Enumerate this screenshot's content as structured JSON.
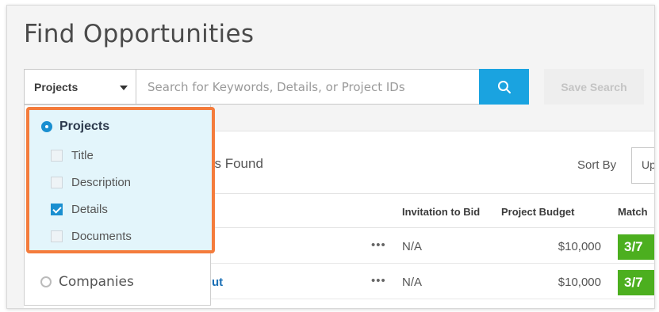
{
  "page": {
    "title": "Find Opportunities"
  },
  "search": {
    "type_selected": "Projects",
    "placeholder": "Search for Keywords, Details, or Project IDs",
    "search_icon": "search-icon",
    "save_label": "Save Search"
  },
  "dropdown": {
    "projects_label": "Projects",
    "projects_checked": true,
    "checkboxes": [
      {
        "label": "Title",
        "checked": false
      },
      {
        "label": "Description",
        "checked": false
      },
      {
        "label": "Details",
        "checked": true
      },
      {
        "label": "Documents",
        "checked": false
      }
    ],
    "companies_label": "Companies",
    "companies_checked": false
  },
  "results": {
    "count_text": "lts Found",
    "sort_label": "Sort By",
    "sort_value": "Up",
    "columns": {
      "invitation": "Invitation to Bid",
      "budget": "Project Budget",
      "match": "Match"
    },
    "rows": [
      {
        "name": "",
        "dots": "•••",
        "invitation": "N/A",
        "budget": "$10,000",
        "match": "3/7"
      },
      {
        "name": "ut",
        "dots": "•••",
        "invitation": "N/A",
        "budget": "$10,000",
        "match": "3/7"
      }
    ]
  },
  "colors": {
    "accent": "#1aa3e0",
    "highlight_border": "#f47c3c",
    "highlight_fill": "#e3f5fb",
    "match_green": "#4caf1f",
    "link_blue": "#1a6fb5"
  }
}
